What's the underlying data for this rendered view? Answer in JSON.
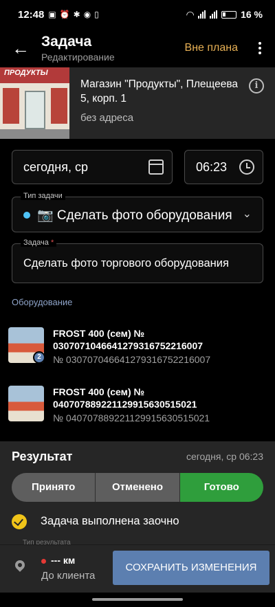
{
  "status_bar": {
    "time": "12:48",
    "battery": "16 %"
  },
  "app_bar": {
    "title": "Задача",
    "subtitle": "Редактирование",
    "plan_label": "Вне плана"
  },
  "store": {
    "sign": "ПРОДУКТЫ",
    "name": "Магазин \"Продукты\", Плещеева 5, корп. 1",
    "address": "без адреса"
  },
  "form": {
    "date_value": "сегодня, ср",
    "time_value": "06:23",
    "task_type_label": "Тип задачи",
    "task_type_value": "📷 Сделать фото оборудования",
    "task_label": "Задача",
    "task_required_mark": "*",
    "task_value": "Сделать фото торгового оборудования"
  },
  "equipment": {
    "header": "Оборудование",
    "items": [
      {
        "title": "FROST 400 (сем) №",
        "code": "030707104664127931675221600 7",
        "number": "№ 0307070466412793167522160 07",
        "badge": "2"
      },
      {
        "title": "FROST 400 (сем) №",
        "code": "040707889221129915630515021",
        "number": "№ 040707889221129915630515021",
        "badge": ""
      }
    ]
  },
  "result": {
    "header": "Результат",
    "timestamp": "сегодня, ср 06:23",
    "options": [
      "Принято",
      "Отменено",
      "Готово"
    ],
    "selected": "Готово",
    "checkbox_label": "Задача выполнена заочно",
    "cut_text": "Тип результата"
  },
  "bottom": {
    "distance": "--- км",
    "distance_label": "До клиента",
    "save_label": "СОХРАНИТЬ ИЗМЕНЕНИЯ"
  },
  "colors": {
    "accent_plan": "#e8b155",
    "primary_button": "#5c7fb0",
    "selected_segment": "#2f9e3c",
    "checkbox": "#f0c419",
    "equipment_header": "#8ea3c8"
  }
}
